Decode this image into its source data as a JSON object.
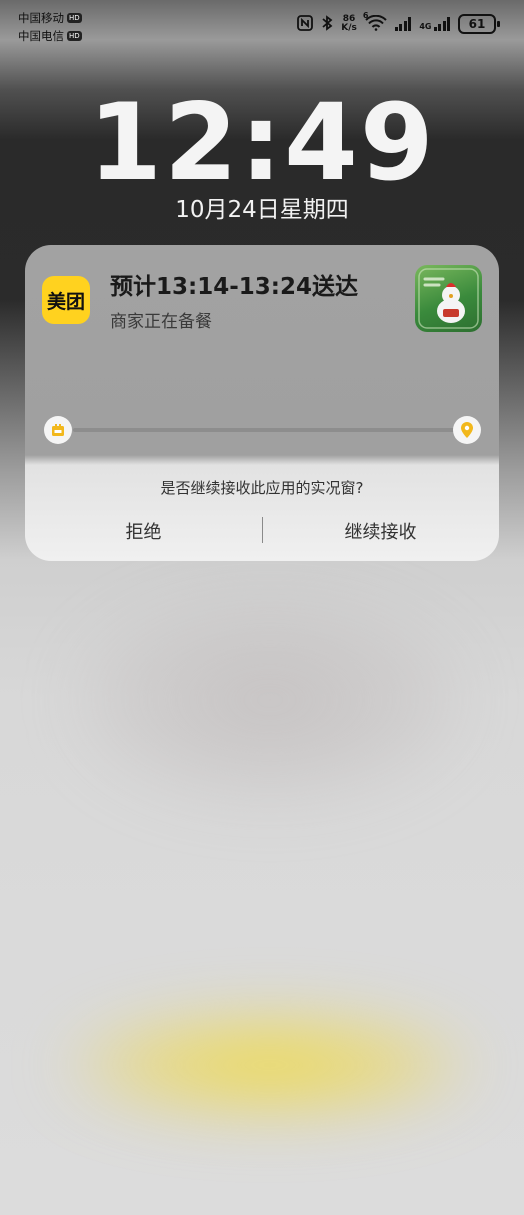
{
  "status_bar": {
    "carrier1": "中国移动",
    "carrier2": "中国电信",
    "hd_badge": "HD",
    "network_speed_value": "86",
    "network_speed_unit": "K/s",
    "wifi_label": "6",
    "cellular_label": "4G",
    "battery": "61",
    "icons": [
      "nfc-icon",
      "bluetooth-icon",
      "wifi-icon",
      "signal-icon",
      "battery-icon"
    ]
  },
  "lockscreen": {
    "time": "12:49",
    "date": "10月24日星期四"
  },
  "live_activity": {
    "app_name": "美团",
    "title": "预计13:14-13:24送达",
    "subtitle": "商家正在备餐",
    "prompt": "是否继续接收此应用的实况窗?",
    "reject_label": "拒绝",
    "accept_label": "继续接收",
    "accent_color": "#ffd21f"
  }
}
